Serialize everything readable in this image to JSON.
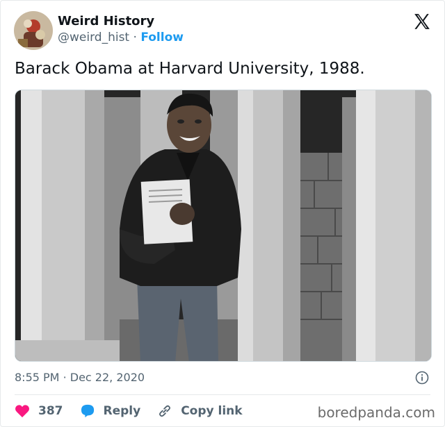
{
  "author": {
    "name": "Weird History",
    "handle": "@weird_hist",
    "separator": "·",
    "follow_label": "Follow"
  },
  "tweet": {
    "text": "Barack Obama at Harvard University, 1988.",
    "time": "8:55 PM",
    "date_separator": "·",
    "date": "Dec 22, 2020"
  },
  "actions": {
    "likes": "387",
    "reply_label": "Reply",
    "copy_link_label": "Copy link"
  },
  "watermark": "boredpanda.com",
  "icons": {
    "platform": "x-logo-icon",
    "info": "info-icon",
    "like": "heart-icon",
    "reply": "speech-bubble-icon",
    "copy": "link-icon"
  },
  "colors": {
    "like": "#f91880",
    "reply": "#1d9bf0",
    "follow": "#1d9bf0",
    "muted": "#536471"
  }
}
